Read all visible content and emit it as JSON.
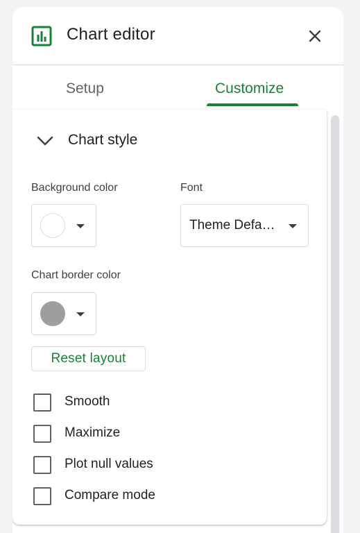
{
  "header": {
    "title": "Chart editor",
    "icon": "bar-chart-icon",
    "close_icon": "close-icon"
  },
  "tabs": [
    {
      "label": "Setup",
      "active": false
    },
    {
      "label": "Customize",
      "active": true
    }
  ],
  "section": {
    "title": "Chart style",
    "expanded": true,
    "icon": "chevron-down-icon"
  },
  "background_color": {
    "label": "Background color",
    "value": "#ffffff"
  },
  "font": {
    "label": "Font",
    "value": "Theme Defa…"
  },
  "border_color": {
    "label": "Chart border color",
    "value": "#9e9e9e"
  },
  "reset_button": {
    "label": "Reset layout"
  },
  "checkboxes": [
    {
      "label": "Smooth",
      "checked": false
    },
    {
      "label": "Maximize",
      "checked": false
    },
    {
      "label": "Plot null values",
      "checked": false
    },
    {
      "label": "Compare mode",
      "checked": false
    }
  ],
  "colors": {
    "accent": "#188038",
    "text_primary": "#202124",
    "text_secondary": "#5f6368",
    "border": "#dadce0"
  }
}
